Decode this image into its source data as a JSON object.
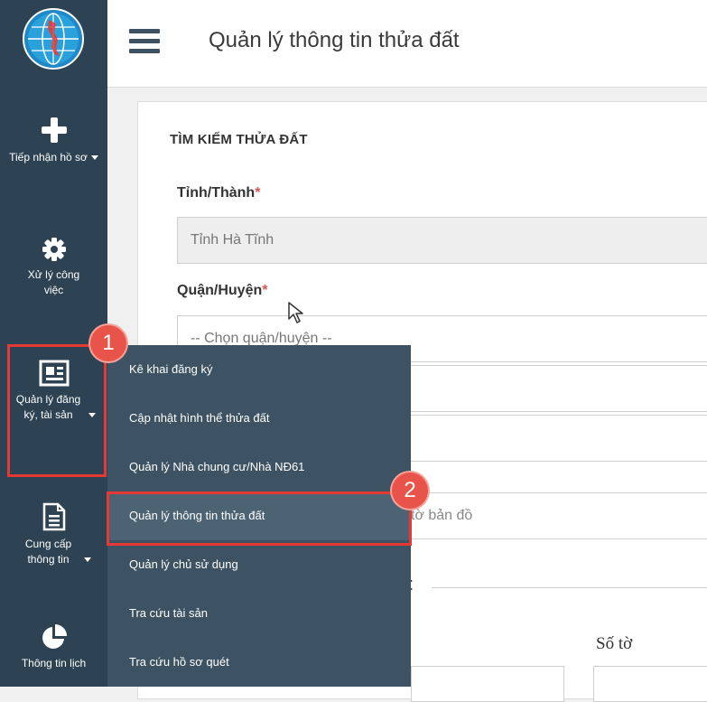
{
  "header": {
    "title": "Quản lý thông tin thửa đất"
  },
  "sidebar": {
    "items": [
      {
        "label": "Tiếp nhận hồ sơ",
        "icon": "plus-icon"
      },
      {
        "label": "Xử lý công việc",
        "icon": "gear-icon"
      },
      {
        "label": "Quản lý đăng ký, tài sản",
        "icon": "newspaper-icon"
      },
      {
        "label": "Cung cấp thông tin",
        "icon": "document-icon"
      },
      {
        "label": "Thông tin lịch",
        "icon": "pie-chart-icon"
      }
    ]
  },
  "search": {
    "section_title": "TÌM KIẾM THỬA ĐẤT",
    "province": {
      "label": "Tỉnh/Thành",
      "value": "Tỉnh Hà Tĩnh"
    },
    "district": {
      "label": "Quận/Huyện",
      "placeholder": "-- Chọn quận/huyện --"
    },
    "map_sheet_fragment": "tờ bản đồ",
    "partial_heading": "t",
    "so_to_label": "Số tờ"
  },
  "dropdown": {
    "items": [
      "Kê khai đăng ký",
      "Cập nhật hình thể thửa đất",
      "Quản lý Nhà chung cư/Nhà NĐ61",
      "Quản lý thông tin thửa đất",
      "Quản lý chủ sử dụng",
      "Tra cứu tài sản",
      "Tra cứu hồ sơ quét"
    ],
    "active_index": 3
  },
  "annotations": {
    "step1": "1",
    "step2": "2"
  },
  "colors": {
    "sidebar": "#2d4252",
    "dropdown": "#3d5262",
    "highlight": "#e53935",
    "required": "#d9534f"
  }
}
